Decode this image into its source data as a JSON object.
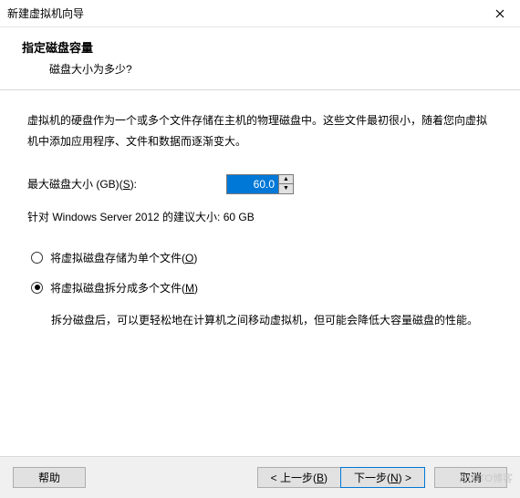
{
  "titlebar": {
    "title": "新建虚拟机向导"
  },
  "header": {
    "title": "指定磁盘容量",
    "subtitle": "磁盘大小为多少?"
  },
  "content": {
    "description": "虚拟机的硬盘作为一个或多个文件存储在主机的物理磁盘中。这些文件最初很小，随着您向虚拟机中添加应用程序、文件和数据而逐渐变大。",
    "size_label_pre": "最大磁盘大小 (GB)(",
    "size_label_key": "S",
    "size_label_post": "):",
    "size_value": "60.0",
    "recommend": "针对 Windows Server 2012 的建议大小: 60 GB",
    "radio_single_pre": "将虚拟磁盘存储为单个文件(",
    "radio_single_key": "O",
    "radio_single_post": ")",
    "radio_multi_pre": "将虚拟磁盘拆分成多个文件(",
    "radio_multi_key": "M",
    "radio_multi_post": ")",
    "radio_multi_desc": "拆分磁盘后，可以更轻松地在计算机之间移动虚拟机，但可能会降低大容量磁盘的性能。"
  },
  "footer": {
    "help": "帮助",
    "back_pre": "< 上一步(",
    "back_key": "B",
    "back_post": ")",
    "next_pre": "下一步(",
    "next_key": "N",
    "next_post": ") >",
    "cancel": "取消"
  },
  "watermark": "51CTO博客"
}
